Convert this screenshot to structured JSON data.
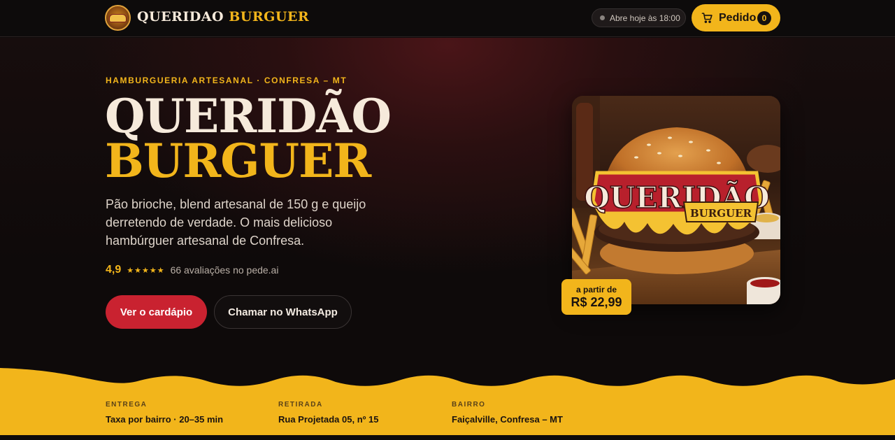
{
  "header": {
    "brand_word1": "QUERIDAO",
    "brand_word2": "BURGUER",
    "status": "Abre hoje às 18:00",
    "order_label": "Pedido",
    "order_count": "0"
  },
  "hero": {
    "kicker": "HAMBURGUERIA ARTESANAL · CONFRESA – MT",
    "title_line1": "QUERIDÃO",
    "title_line2": "BURGUER",
    "description": "Pão brioche, blend artesanal de 150 g e queijo derretendo de verdade. O mais delicioso hambúrguer artesanal de Confresa.",
    "rating_value": "4,9",
    "stars": "★★★★★",
    "rating_count": "66 avaliações no pede.ai",
    "primary_button": "Ver o cardápio",
    "secondary_button": "Chamar no WhatsApp"
  },
  "product": {
    "burger_text1": "QUERIDÃO",
    "burger_text2": "BURGUER",
    "price_from": "a partir de",
    "price_value": "R$ 22,99"
  },
  "info": [
    {
      "label": "ENTREGA",
      "value": "Taxa por bairro · 20–35 min"
    },
    {
      "label": "RETIRADA",
      "value": "Rua Projetada 05, nº 15"
    },
    {
      "label": "BAIRRO",
      "value": "Faiçalville, Confresa – MT"
    }
  ],
  "colors": {
    "accent": "#f2b51b",
    "primary_button": "#c92230",
    "background": "#0e0a0a"
  },
  "icons": [
    "logo-badge",
    "cart-icon",
    "status-dot-icon"
  ]
}
